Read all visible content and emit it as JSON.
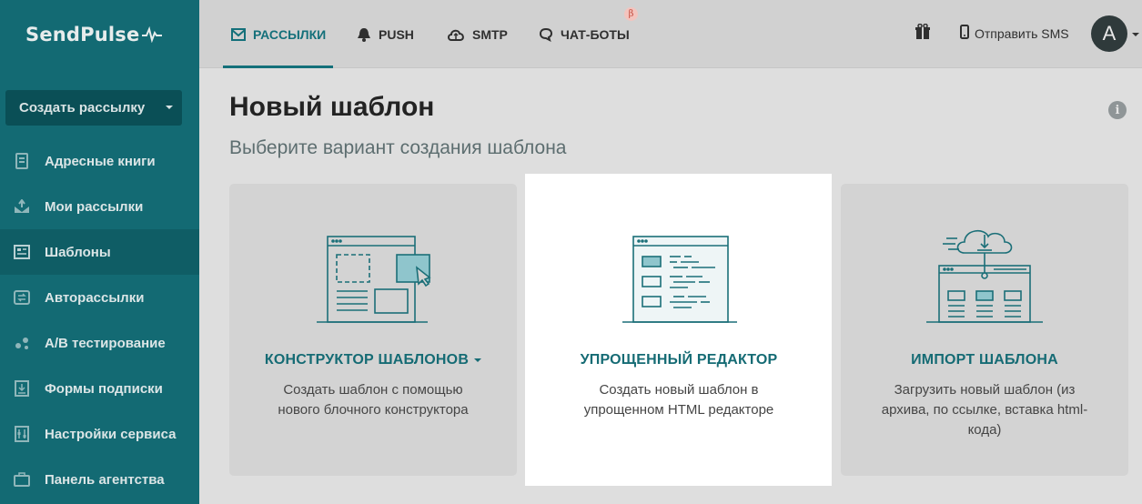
{
  "brand": {
    "name": "SendPulse"
  },
  "sidebar": {
    "create_button": "Создать рассылку",
    "items": [
      {
        "label": "Адресные книги",
        "icon": "address-book-icon"
      },
      {
        "label": "Мои рассылки",
        "icon": "campaigns-icon"
      },
      {
        "label": "Шаблоны",
        "icon": "templates-icon",
        "active": true
      },
      {
        "label": "Авторассылки",
        "icon": "automation-icon"
      },
      {
        "label": "A/B тестирование",
        "icon": "ab-test-icon"
      },
      {
        "label": "Формы подписки",
        "icon": "subscription-forms-icon"
      },
      {
        "label": "Настройки сервиса",
        "icon": "settings-icon"
      },
      {
        "label": "Панель агентства",
        "icon": "agency-panel-icon"
      }
    ]
  },
  "topbar": {
    "tabs": [
      {
        "label": "РАССЫЛКИ",
        "icon": "mail-icon",
        "active": true
      },
      {
        "label": "PUSH",
        "icon": "bell-icon"
      },
      {
        "label": "SMTP",
        "icon": "cloud-icon"
      },
      {
        "label": "ЧАТ-БОТЫ",
        "icon": "chat-icon"
      }
    ],
    "beta_badge": "β",
    "sms_label": "Отправить SMS",
    "avatar_letter": "A"
  },
  "main": {
    "title": "Новый шаблон",
    "subtitle": "Выберите вариант создания шаблона",
    "info": "i",
    "cards": [
      {
        "title": "КОНСТРУКТОР ШАБЛОНОВ",
        "description": "Создать шаблон с помощью нового блочного конструктора",
        "has_dropdown": true
      },
      {
        "title": "УПРОЩЕННЫЙ РЕДАКТОР",
        "description": "Создать новый шаблон в упрощенном HTML редакторе",
        "highlighted": true
      },
      {
        "title": "ИМПОРТ ШАБЛОНА",
        "description": "Загрузить новый шаблон (из архива, по ссылке, вставка html-кода)"
      }
    ]
  },
  "colors": {
    "sidebar_bg": "#136a73",
    "accent": "#14707a",
    "page_bg": "#dedede"
  }
}
